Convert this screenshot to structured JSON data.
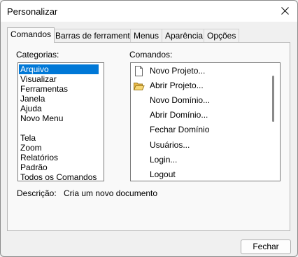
{
  "window": {
    "title": "Personalizar"
  },
  "tabs": [
    {
      "label": "Comandos",
      "active": true
    },
    {
      "label": "Barras de ferramentas",
      "active": false
    },
    {
      "label": "Menus",
      "active": false
    },
    {
      "label": "Aparência",
      "active": false
    },
    {
      "label": "Opções",
      "active": false
    }
  ],
  "categories": {
    "label": "Categorias:",
    "selected": "Arquivo",
    "items": [
      "Arquivo",
      "Visualizar",
      "Ferramentas",
      "Janela",
      "Ajuda",
      "Novo Menu",
      "",
      "Tela",
      "Zoom",
      "Relatórios",
      "Padrão",
      "Todos os Comandos"
    ]
  },
  "commands": {
    "label": "Comandos:",
    "items": [
      {
        "label": "Novo Projeto...",
        "icon": "new-document-icon"
      },
      {
        "label": "Abrir Projeto...",
        "icon": "open-folder-icon"
      },
      {
        "label": "Novo Domínio...",
        "icon": ""
      },
      {
        "label": "Abrir Domínio...",
        "icon": ""
      },
      {
        "label": "Fechar Domínio",
        "icon": ""
      },
      {
        "label": "Usuários...",
        "icon": ""
      },
      {
        "label": "Login...",
        "icon": ""
      },
      {
        "label": "Logout",
        "icon": ""
      }
    ]
  },
  "description": {
    "label": "Descrição:",
    "text": "Cria um novo documento"
  },
  "buttons": {
    "close": "Fechar"
  },
  "colors": {
    "selection": "#0078d7",
    "window_bg": "#f0f0f0",
    "panel_bg": "#f9f9f9"
  }
}
